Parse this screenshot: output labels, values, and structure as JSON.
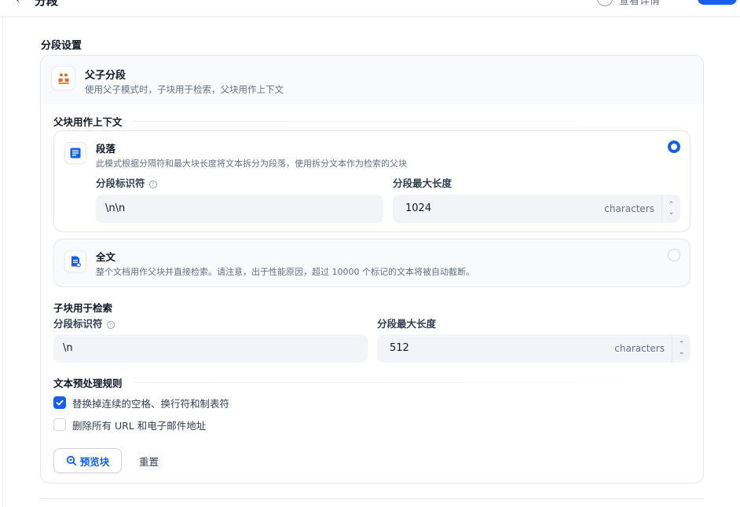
{
  "header": {
    "back_icon": "chevron-left-icon",
    "title": "分段",
    "option_label": "查看详情"
  },
  "section": {
    "title": "分段设置"
  },
  "mode": {
    "title": "父子分段",
    "description": "使用父子模式时，子块用于检索，父块用作上下文",
    "icon": "parent-child-icon",
    "icon_color": "#e26a2c"
  },
  "parent": {
    "title": "父块用作上下文",
    "paragraph": {
      "title": "段落",
      "description": "此模式根据分隔符和最大块长度将文本拆分为段落，使用拆分文本作为检索的父块",
      "selected": true,
      "delimiter_label": "分段标识符",
      "delimiter_value": "\\n\\n",
      "maxlen_label": "分段最大长度",
      "maxlen_value": "1024",
      "unit": "characters"
    },
    "fulltext": {
      "title": "全文",
      "description": "整个文档用作父块并直接检索。请注意，出于性能原因，超过 10000 个标记的文本将被自动截断。",
      "selected": false
    }
  },
  "child": {
    "title": "子块用于检索",
    "delimiter_label": "分段标识符",
    "delimiter_value": "\\n",
    "maxlen_label": "分段最大长度",
    "maxlen_value": "512",
    "unit": "characters"
  },
  "rules": {
    "title": "文本预处理规则",
    "items": [
      {
        "label": "替换掉连续的空格、换行符和制表符",
        "checked": true
      },
      {
        "label": "删除所有 URL 和电子邮件地址",
        "checked": false
      }
    ]
  },
  "actions": {
    "preview_label": "预览块",
    "reset_label": "重置"
  },
  "colors": {
    "accent": "#155eef",
    "field_bg": "#f2f4f7",
    "border": "#e4e7ec"
  }
}
